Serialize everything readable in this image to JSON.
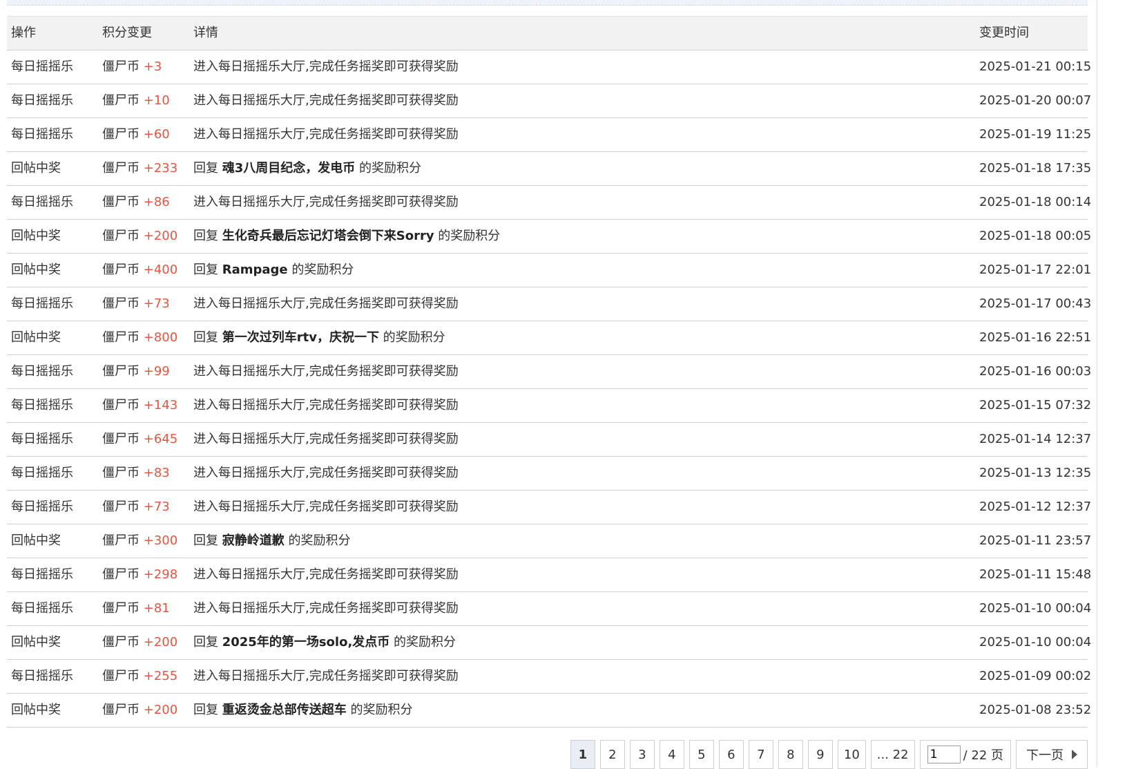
{
  "table": {
    "headers": {
      "op": "操作",
      "change": "积分变更",
      "detail": "详情",
      "time": "变更时间"
    },
    "rows": [
      {
        "op": "每日摇摇乐",
        "currency": "僵尸币",
        "amount": "+3",
        "detail_prefix": "进入每日摇摇乐大厅,完成任务摇奖即可获得奖励",
        "detail_bold": "",
        "detail_suffix": "",
        "time": "2025-01-21 00:15"
      },
      {
        "op": "每日摇摇乐",
        "currency": "僵尸币",
        "amount": "+10",
        "detail_prefix": "进入每日摇摇乐大厅,完成任务摇奖即可获得奖励",
        "detail_bold": "",
        "detail_suffix": "",
        "time": "2025-01-20 00:07"
      },
      {
        "op": "每日摇摇乐",
        "currency": "僵尸币",
        "amount": "+60",
        "detail_prefix": "进入每日摇摇乐大厅,完成任务摇奖即可获得奖励",
        "detail_bold": "",
        "detail_suffix": "",
        "time": "2025-01-19 11:25"
      },
      {
        "op": "回帖中奖",
        "currency": "僵尸币",
        "amount": "+233",
        "detail_prefix": "回复 ",
        "detail_bold": "魂3八周目纪念，发电币",
        "detail_suffix": " 的奖励积分",
        "time": "2025-01-18 17:35"
      },
      {
        "op": "每日摇摇乐",
        "currency": "僵尸币",
        "amount": "+86",
        "detail_prefix": "进入每日摇摇乐大厅,完成任务摇奖即可获得奖励",
        "detail_bold": "",
        "detail_suffix": "",
        "time": "2025-01-18 00:14"
      },
      {
        "op": "回帖中奖",
        "currency": "僵尸币",
        "amount": "+200",
        "detail_prefix": "回复 ",
        "detail_bold": "生化奇兵最后忘记灯塔会倒下来Sorry",
        "detail_suffix": " 的奖励积分",
        "time": "2025-01-18 00:05"
      },
      {
        "op": "回帖中奖",
        "currency": "僵尸币",
        "amount": "+400",
        "detail_prefix": "回复 ",
        "detail_bold": "Rampage",
        "detail_suffix": " 的奖励积分",
        "time": "2025-01-17 22:01"
      },
      {
        "op": "每日摇摇乐",
        "currency": "僵尸币",
        "amount": "+73",
        "detail_prefix": "进入每日摇摇乐大厅,完成任务摇奖即可获得奖励",
        "detail_bold": "",
        "detail_suffix": "",
        "time": "2025-01-17 00:43"
      },
      {
        "op": "回帖中奖",
        "currency": "僵尸币",
        "amount": "+800",
        "detail_prefix": "回复 ",
        "detail_bold": "第一次过列车rtv，庆祝一下",
        "detail_suffix": " 的奖励积分",
        "time": "2025-01-16 22:51"
      },
      {
        "op": "每日摇摇乐",
        "currency": "僵尸币",
        "amount": "+99",
        "detail_prefix": "进入每日摇摇乐大厅,完成任务摇奖即可获得奖励",
        "detail_bold": "",
        "detail_suffix": "",
        "time": "2025-01-16 00:03"
      },
      {
        "op": "每日摇摇乐",
        "currency": "僵尸币",
        "amount": "+143",
        "detail_prefix": "进入每日摇摇乐大厅,完成任务摇奖即可获得奖励",
        "detail_bold": "",
        "detail_suffix": "",
        "time": "2025-01-15 07:32"
      },
      {
        "op": "每日摇摇乐",
        "currency": "僵尸币",
        "amount": "+645",
        "detail_prefix": "进入每日摇摇乐大厅,完成任务摇奖即可获得奖励",
        "detail_bold": "",
        "detail_suffix": "",
        "time": "2025-01-14 12:37"
      },
      {
        "op": "每日摇摇乐",
        "currency": "僵尸币",
        "amount": "+83",
        "detail_prefix": "进入每日摇摇乐大厅,完成任务摇奖即可获得奖励",
        "detail_bold": "",
        "detail_suffix": "",
        "time": "2025-01-13 12:35"
      },
      {
        "op": "每日摇摇乐",
        "currency": "僵尸币",
        "amount": "+73",
        "detail_prefix": "进入每日摇摇乐大厅,完成任务摇奖即可获得奖励",
        "detail_bold": "",
        "detail_suffix": "",
        "time": "2025-01-12 12:37"
      },
      {
        "op": "回帖中奖",
        "currency": "僵尸币",
        "amount": "+300",
        "detail_prefix": "回复 ",
        "detail_bold": "寂静岭道歉",
        "detail_suffix": " 的奖励积分",
        "time": "2025-01-11 23:57"
      },
      {
        "op": "每日摇摇乐",
        "currency": "僵尸币",
        "amount": "+298",
        "detail_prefix": "进入每日摇摇乐大厅,完成任务摇奖即可获得奖励",
        "detail_bold": "",
        "detail_suffix": "",
        "time": "2025-01-11 15:48"
      },
      {
        "op": "每日摇摇乐",
        "currency": "僵尸币",
        "amount": "+81",
        "detail_prefix": "进入每日摇摇乐大厅,完成任务摇奖即可获得奖励",
        "detail_bold": "",
        "detail_suffix": "",
        "time": "2025-01-10 00:04"
      },
      {
        "op": "回帖中奖",
        "currency": "僵尸币",
        "amount": "+200",
        "detail_prefix": "回复 ",
        "detail_bold": "2025年的第一场solo,发点币",
        "detail_suffix": " 的奖励积分",
        "time": "2025-01-10 00:04"
      },
      {
        "op": "每日摇摇乐",
        "currency": "僵尸币",
        "amount": "+255",
        "detail_prefix": "进入每日摇摇乐大厅,完成任务摇奖即可获得奖励",
        "detail_bold": "",
        "detail_suffix": "",
        "time": "2025-01-09 00:02"
      },
      {
        "op": "回帖中奖",
        "currency": "僵尸币",
        "amount": "+200",
        "detail_prefix": "回复 ",
        "detail_bold": "重返烫金总部传送超车",
        "detail_suffix": " 的奖励积分",
        "time": "2025-01-08 23:52"
      }
    ]
  },
  "pagination": {
    "pages": [
      "1",
      "2",
      "3",
      "4",
      "5",
      "6",
      "7",
      "8",
      "9",
      "10"
    ],
    "last": "... 22",
    "jump_value": "1",
    "total_label": "/ 22 页",
    "next_label": "下一页"
  }
}
